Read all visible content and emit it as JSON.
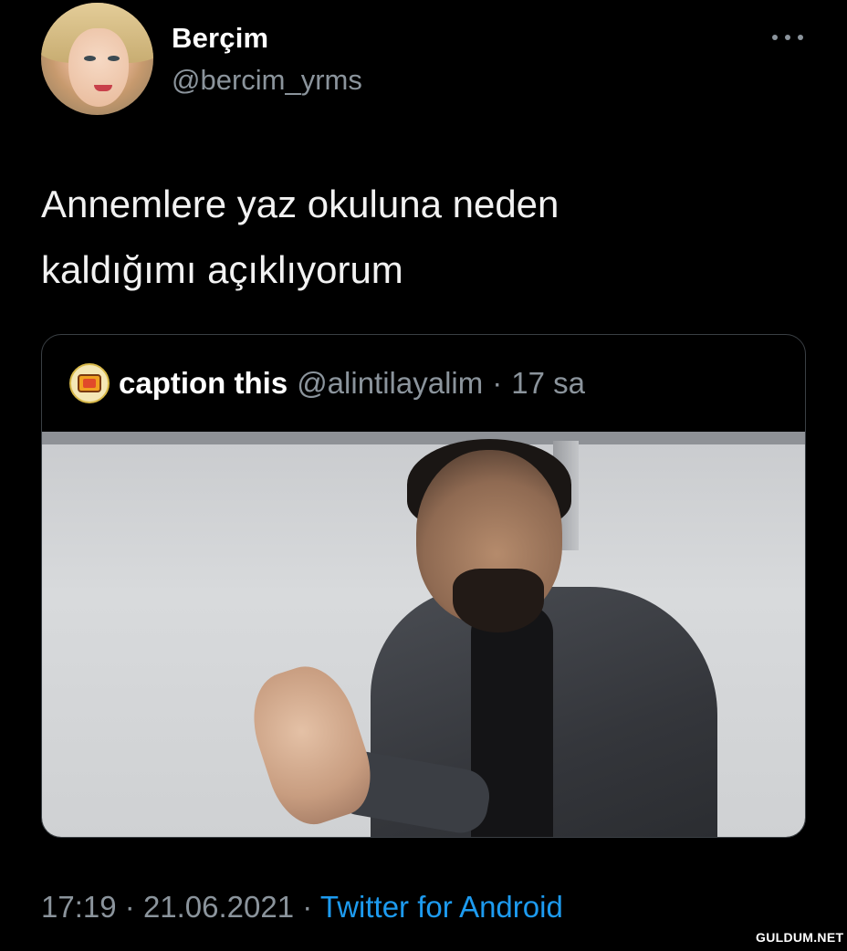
{
  "author": {
    "display_name": "Berçim",
    "handle": "@bercim_yrms",
    "more_icon": "more-horizontal-icon"
  },
  "tweet": {
    "text_line1": "Annemlere yaz okuluna neden",
    "text_line2": "kaldığımı açıklıyorum"
  },
  "quoted_tweet": {
    "name": "caption this",
    "handle": "@alintilayalim",
    "separator": "·",
    "time": "17 sa",
    "avatar_icon": "tv-logo-icon"
  },
  "meta": {
    "time": "17:19",
    "separator1": "·",
    "date": "21.06.2021",
    "separator2": "·",
    "source": "Twitter for Android"
  },
  "watermark": "GULDUM.NET",
  "colors": {
    "background": "#000000",
    "secondary_text": "#8b949c",
    "link": "#1d9bf0",
    "card_border": "#3a3f44"
  }
}
